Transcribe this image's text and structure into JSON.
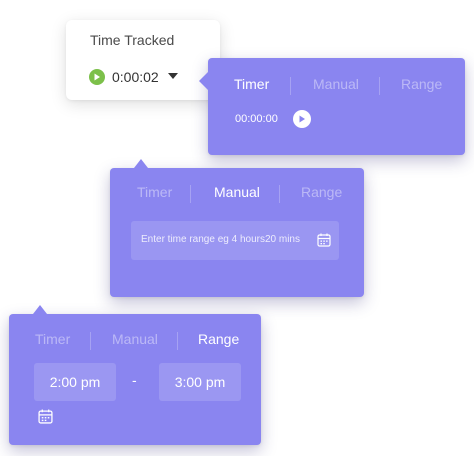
{
  "widget": {
    "title": "Time Tracked",
    "elapsed": "0:00:02",
    "icons": {
      "play": "play-icon",
      "dropdown": "caret-down-icon"
    },
    "colors": {
      "play": "#7cc04a"
    }
  },
  "tabs": [
    "Timer",
    "Manual",
    "Range"
  ],
  "colors": {
    "panel": "#8a85f0"
  },
  "timer_panel": {
    "active_tab": "Timer",
    "time": "00:00:00",
    "icon": "play-icon"
  },
  "manual_panel": {
    "active_tab": "Manual",
    "placeholder": "Enter time range eg 4 hours20 mins",
    "icon": "calendar-icon"
  },
  "range_panel": {
    "active_tab": "Range",
    "start": "2:00 pm",
    "separator": "-",
    "end": "3:00 pm",
    "icon": "calendar-icon"
  }
}
